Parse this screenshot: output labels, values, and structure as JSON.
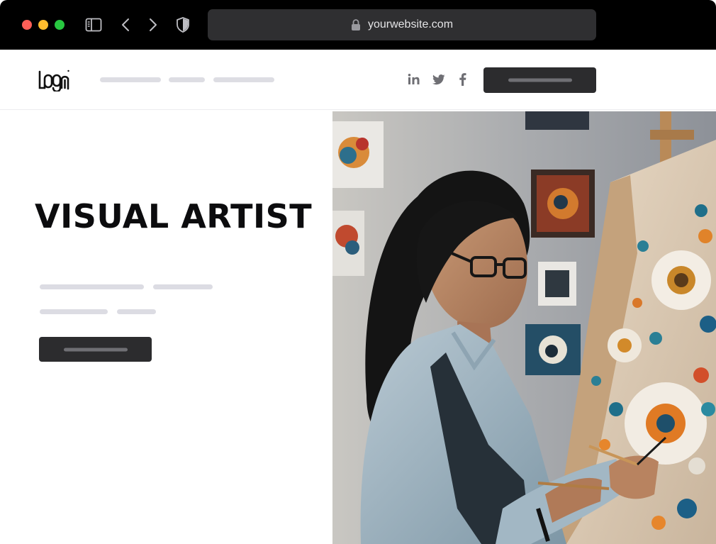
{
  "browser": {
    "url": "yourwebsite.com",
    "traffic_lights": {
      "close": "#ff5f57",
      "minimize": "#febc2e",
      "maximize": "#28c840"
    },
    "icons": [
      "sidebar-icon",
      "chevron-left-icon",
      "chevron-right-icon",
      "shield-icon",
      "lock-icon"
    ]
  },
  "header": {
    "logo": "LOGO",
    "nav_placeholders": 3,
    "social_icons": [
      "linkedin-icon",
      "twitter-icon",
      "facebook-icon"
    ]
  },
  "hero": {
    "title": "VISUAL ARTIST",
    "image_subject": "woman with glasses painting flowers on canvas at an easel"
  },
  "colors": {
    "chrome_bg": "#000000",
    "address_bar_bg": "#2f2f31",
    "button_dark": "#2c2c2e",
    "placeholder_line": "#dcdce3",
    "title_text": "#0c0c0e"
  }
}
